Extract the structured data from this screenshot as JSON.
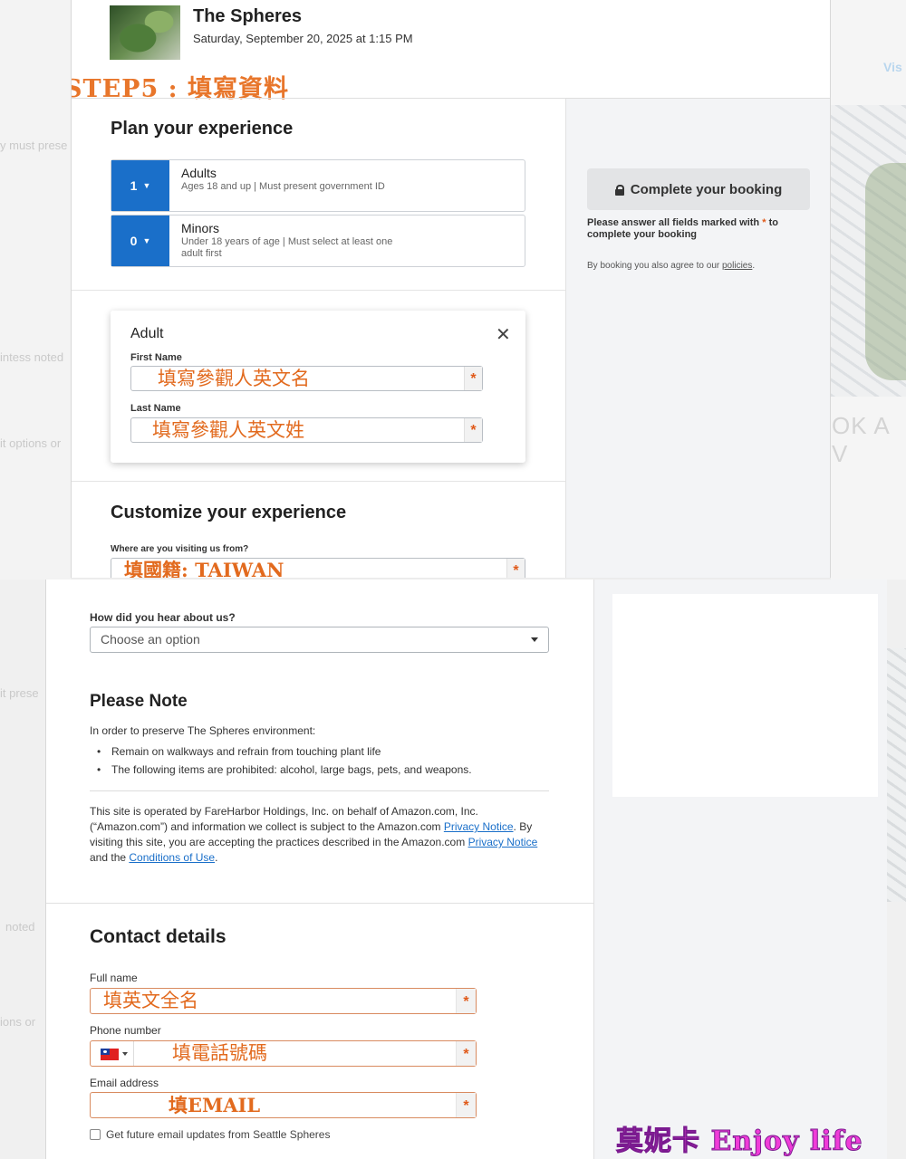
{
  "header": {
    "title": "The Spheres",
    "date": "Saturday, September 20, 2025 at 1:15 PM",
    "step_banner": "STEP5 : 填寫資料"
  },
  "background": {
    "ghost_texts": [
      "y must prese",
      "intess noted",
      "it options or",
      "Vis",
      "OK A V",
      "it prese",
      "noted",
      "ions or"
    ]
  },
  "plan": {
    "title": "Plan your experience",
    "tickets": [
      {
        "qty": "1",
        "name": "Adults",
        "desc": "Ages 18 and up | Must present government ID"
      },
      {
        "qty": "0",
        "name": "Minors",
        "desc": "Under 18 years of age | Must select at least one adult first"
      }
    ]
  },
  "adult_form": {
    "title": "Adult",
    "first_name_label": "First Name",
    "first_name_hint": "填寫參觀人英文名",
    "last_name_label": "Last Name",
    "last_name_hint": "填寫參觀人英文姓",
    "required_mark": "*"
  },
  "customize": {
    "title": "Customize your experience",
    "origin_label": "Where are you visiting us from?",
    "origin_hint": "填國籍: TAIWAN",
    "hear_label": "How did you hear about us?",
    "hear_placeholder": "Choose an option"
  },
  "sidebar": {
    "book_button": "Complete your booking",
    "required_note_a": "Please answer all fields marked with",
    "required_note_b": "to complete your booking",
    "agree_text": "By booking you also agree to our",
    "policies_link": "policies",
    "agree_end": "."
  },
  "please_note": {
    "title": "Please Note",
    "intro": "In order to preserve The Spheres environment:",
    "items": [
      "Remain on walkways and refrain from touching plant life",
      "The following items are prohibited: alcohol, large bags, pets, and weapons."
    ],
    "legal_1": "This site is operated by FareHarbor Holdings, Inc. on behalf of Amazon.com, Inc. (“Amazon.com”) and information we collect is subject to the Amazon.com",
    "privacy_link_1": "Privacy Notice",
    "legal_2": ". By visiting this site, you are accepting the practices described in the Amazon.com",
    "privacy_link_2": "Privacy Notice",
    "legal_3": "and the",
    "conditions_link": "Conditions of Use",
    "legal_4": "."
  },
  "contact": {
    "title": "Contact details",
    "full_name_label": "Full name",
    "full_name_hint": "填英文全名",
    "phone_label": "Phone number",
    "phone_hint": "填電話號碼",
    "email_label": "Email address",
    "email_hint": "填EMAIL",
    "updates_label": "Get future email updates from Seattle Spheres"
  },
  "watermark": "莫妮卡 Enjoy life",
  "colors": {
    "accent": "#1a6fc9",
    "required": "#e05a1a",
    "annotation": "#e8762b",
    "watermark": "#f03cd8"
  }
}
